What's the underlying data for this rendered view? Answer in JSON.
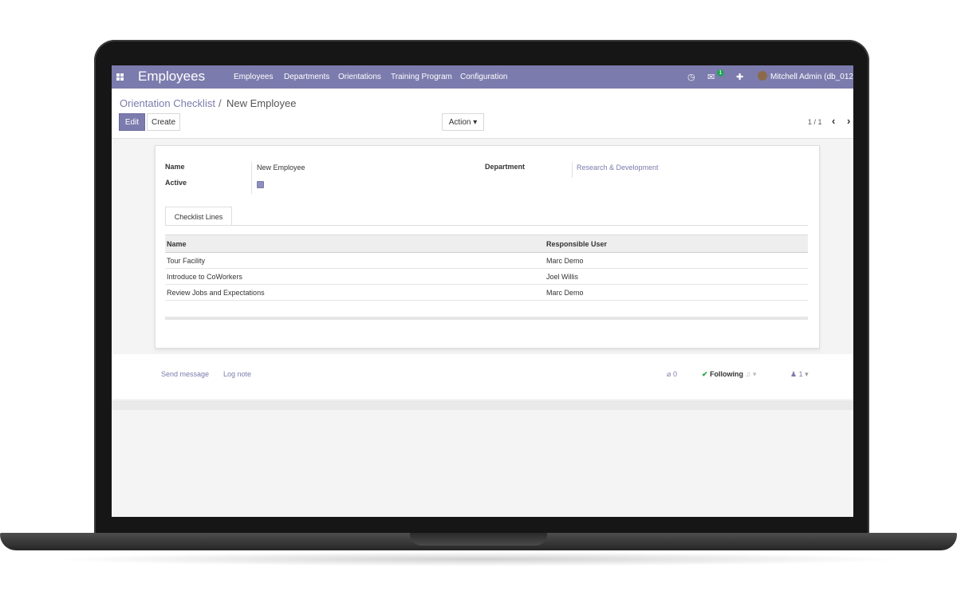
{
  "navbar": {
    "app_title": "Employees",
    "menu": [
      "Employees",
      "Departments",
      "Orientations",
      "Training Program",
      "Configuration"
    ],
    "message_count": "1",
    "user": "Mitchell Admin (db_012)",
    "icons": [
      "apps-grid-icon",
      "clock-icon",
      "chat-icon",
      "gift-icon"
    ]
  },
  "breadcrumb": {
    "parent": "Orientation Checklist",
    "separator": "/",
    "current": "New Employee"
  },
  "buttons": {
    "edit": "Edit",
    "create": "Create",
    "action": "Action ▾"
  },
  "pager": {
    "value": "1 / 1",
    "prev": "‹",
    "next": "›"
  },
  "form": {
    "name_label": "Name",
    "name_value": "New Employee",
    "active_label": "Active",
    "active_checked": true,
    "department_label": "Department",
    "department_value": "Research & Development",
    "tab": "Checklist Lines",
    "table": {
      "headers": [
        "Name",
        "Responsible User"
      ],
      "rows": [
        [
          "Tour Facility",
          "Marc Demo"
        ],
        [
          "Introduce to CoWorkers",
          "Joel Willis"
        ],
        [
          "Review Jobs and Expectations",
          "Marc Demo"
        ]
      ]
    }
  },
  "chatter": {
    "send_message": "Send message",
    "log_note": "Log note",
    "attachments": "0",
    "following": "Following",
    "followers": "1"
  },
  "colors": {
    "brand": "#7c7bad",
    "success": "#28a745"
  }
}
